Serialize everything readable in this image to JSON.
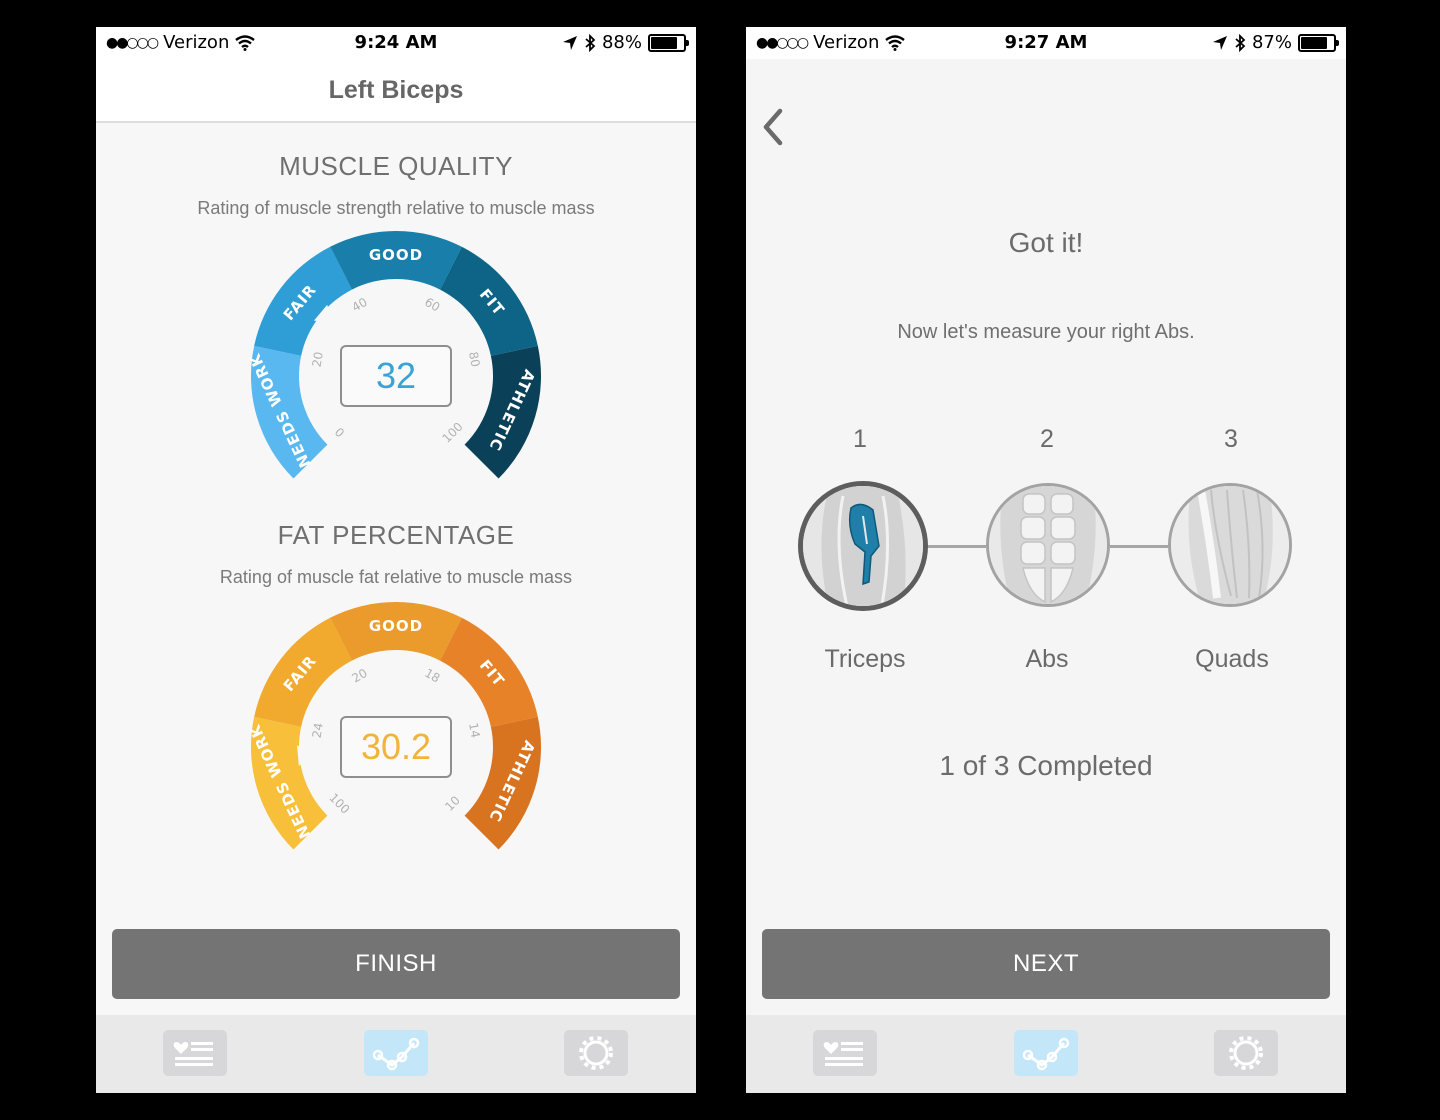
{
  "left_screen": {
    "status": {
      "carrier": "Verizon",
      "time": "9:24 AM",
      "battery": "88%",
      "battery_fill": 0.88
    },
    "nav_title": "Left Biceps",
    "muscle_quality": {
      "title": "MUSCLE QUALITY",
      "subtitle": "Rating of muscle strength relative to muscle mass",
      "value": "32",
      "value_color": "#3aa3d6",
      "bands": [
        "NEEDS WORK",
        "FAIR",
        "GOOD",
        "FIT",
        "ATHLETIC"
      ],
      "band_colors": [
        "#58b8ef",
        "#2f9ed6",
        "#1a7eab",
        "#0e6486",
        "#0a4158"
      ],
      "ticks": [
        "0",
        "20",
        "40",
        "60",
        "80",
        "100"
      ]
    },
    "fat_percentage": {
      "title": "FAT PERCENTAGE",
      "subtitle": "Rating of muscle fat relative to muscle mass",
      "value": "30.2",
      "value_color": "#f2b33a",
      "bands": [
        "NEEDS WORK",
        "FAIR",
        "GOOD",
        "FIT",
        "ATHLETIC"
      ],
      "band_colors": [
        "#f7bf3a",
        "#f2aa2e",
        "#eb9a2c",
        "#e88229",
        "#d8731f"
      ],
      "ticks": [
        "100",
        "24",
        "20",
        "18",
        "14",
        "10"
      ]
    },
    "button_label": "FINISH",
    "tabs": [
      {
        "icon": "heart-list-icon",
        "active": false
      },
      {
        "icon": "chart-line-icon",
        "active": true
      },
      {
        "icon": "gear-icon",
        "active": false
      }
    ]
  },
  "right_screen": {
    "status": {
      "carrier": "Verizon",
      "time": "9:27 AM",
      "battery": "87%",
      "battery_fill": 0.87
    },
    "heading": "Got it!",
    "message": "Now let's measure your right Abs.",
    "steps": [
      {
        "number": "1",
        "label": "Triceps"
      },
      {
        "number": "2",
        "label": "Abs"
      },
      {
        "number": "3",
        "label": "Quads"
      }
    ],
    "progress_text": "1 of 3 Completed",
    "button_label": "NEXT",
    "tabs": [
      {
        "icon": "heart-list-icon",
        "active": false
      },
      {
        "icon": "chart-line-icon",
        "active": true
      },
      {
        "icon": "gear-icon",
        "active": false
      }
    ]
  }
}
